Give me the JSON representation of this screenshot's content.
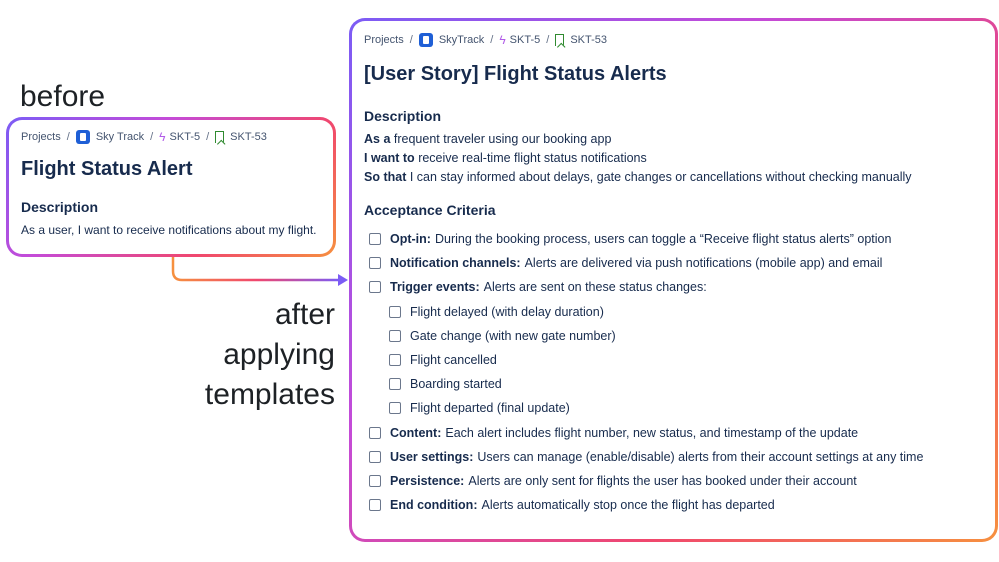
{
  "labels": {
    "before": "before",
    "after_lines": [
      "after",
      "applying",
      "templates"
    ]
  },
  "before_card": {
    "breadcrumb": {
      "projects": "Projects",
      "project": "Sky Track",
      "epic": "SKT-5",
      "issue": "SKT-53",
      "separator": "/"
    },
    "title": "Flight Status Alert",
    "description_heading": "Description",
    "description": "As a user, I want to receive notifications about my flight."
  },
  "after_card": {
    "breadcrumb": {
      "projects": "Projects",
      "project": "SkyTrack",
      "epic": "SKT-5",
      "issue": "SKT-53",
      "separator": "/"
    },
    "title": "[User Story] Flight Status Alerts",
    "description_heading": "Description",
    "story": [
      {
        "lead": "As a",
        "text": "frequent traveler using our booking app"
      },
      {
        "lead": "I want to",
        "text": "receive real-time flight status notifications"
      },
      {
        "lead": "So that",
        "text": "I can stay informed about delays, gate changes or cancellations without checking manually"
      }
    ],
    "acceptance_heading": "Acceptance Criteria",
    "criteria": [
      {
        "label": "Opt-in:",
        "text": "During the booking process, users can toggle a “Receive flight status alerts” option"
      },
      {
        "label": "Notification channels:",
        "text": "Alerts are delivered via push notifications (mobile app) and email"
      },
      {
        "label": "Trigger events:",
        "text": "Alerts are sent on these status changes:"
      },
      {
        "label": "",
        "text": "Flight delayed (with delay duration)"
      },
      {
        "label": "",
        "text": "Gate change (with new gate number)"
      },
      {
        "label": "",
        "text": "Flight cancelled"
      },
      {
        "label": "",
        "text": "Boarding started"
      },
      {
        "label": "",
        "text": "Flight departed (final update)"
      },
      {
        "label": "Content:",
        "text": "Each alert includes flight number, new status, and timestamp of the update"
      },
      {
        "label": "User settings:",
        "text": "Users can manage (enable/disable) alerts from their account settings at any time"
      },
      {
        "label": "Persistence:",
        "text": "Alerts are only sent for flights the user has booked under their account"
      },
      {
        "label": "End condition:",
        "text": "Alerts automatically stop once the flight has departed"
      }
    ]
  },
  "colors": {
    "gradient_start": "#7b5cf5",
    "gradient_mid": "#f0476e",
    "gradient_end": "#f6903f",
    "arrow": "#7b5cf5"
  }
}
